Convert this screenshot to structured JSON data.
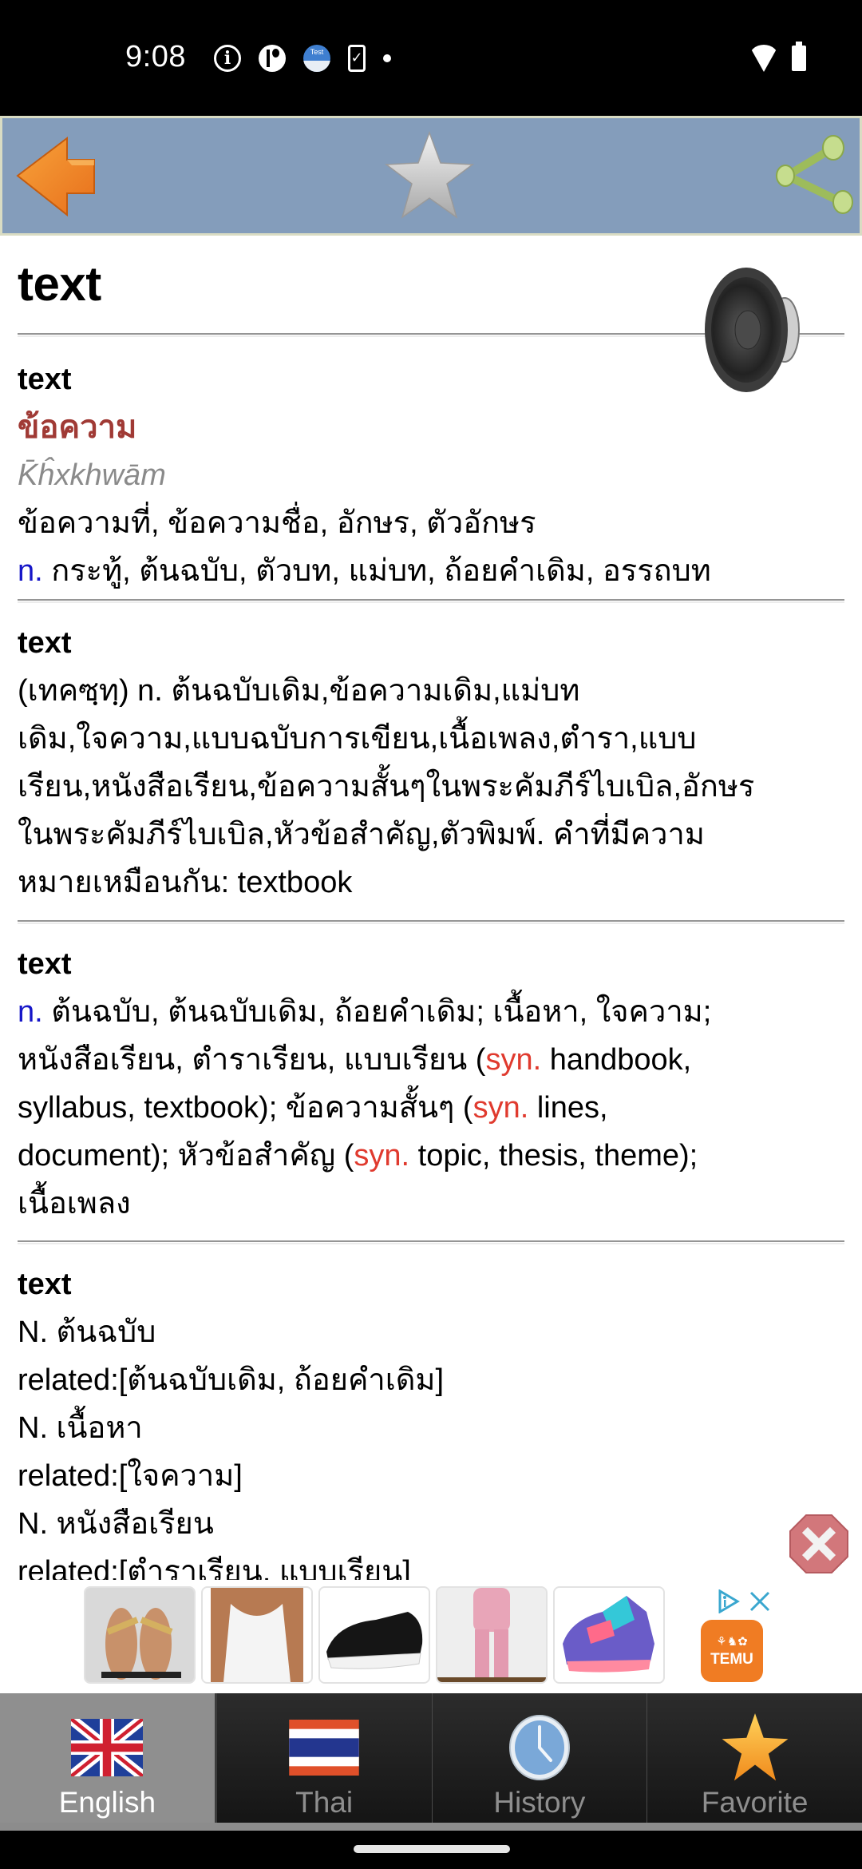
{
  "status_bar": {
    "time": "9:08",
    "left_icons": [
      "info-icon",
      "app-notification-icon",
      "test-app-icon",
      "phone-check-icon",
      "more-dot-icon"
    ],
    "right_icons": [
      "wifi-icon",
      "battery-charging-icon"
    ],
    "test_badge": "Test"
  },
  "toolbar": {
    "back_icon": "back-arrow-icon",
    "favorite_icon": "star-icon",
    "share_icon": "share-icon"
  },
  "word": {
    "headword": "text",
    "speaker_icon": "speaker-icon"
  },
  "entries": [
    {
      "word": "text",
      "thai": "ข้อความ",
      "transliteration": "K̄ĥxkhwām",
      "meanings": "ข้อความที่, ข้อความชื่อ, อักษร, ตัวอักษร",
      "pos": "n.",
      "pos_meanings": " กระทู้, ต้นฉบับ, ตัวบท, แม่บท, ถ้อยคำเดิม, อรรถบท"
    },
    {
      "word": "text",
      "lines": [
        "(เทคซฺทฺ) n. ต้นฉบับเดิม,ข้อความเดิม,แม่บท",
        "เดิม,ใจความ,แบบฉบับการเขียน,เนื้อเพลง,ตำรา,แบบ",
        "เรียน,หนังสือเรียน,ข้อความสั้นๆในพระคัมภีร์ไบเบิล,อักษร",
        "ในพระคัมภีร์ไบเบิล,หัวข้อสำคัญ,ตัวพิมพ์. คำที่มีความ",
        "หมายเหมือนกัน: textbook"
      ]
    },
    {
      "word": "text",
      "pos": "n.",
      "segments": [
        {
          "text": " ต้นฉบับ, ต้นฉบับเดิม, ถ้อยคำเดิม; เนื้อหา, ใจความ;",
          "break_after": true
        },
        {
          "text": "หนังสือเรียน, ตำราเรียน, แบบเรียน ("
        },
        {
          "syn": "syn."
        },
        {
          "text": " handbook,",
          "break_after": true
        },
        {
          "text": "syllabus, textbook); ข้อความสั้นๆ ("
        },
        {
          "syn": "syn."
        },
        {
          "text": " lines,",
          "break_after": true
        },
        {
          "text": "document); หัวข้อสำคัญ ("
        },
        {
          "syn": "syn."
        },
        {
          "text": " topic, thesis, theme);",
          "break_after": true
        },
        {
          "text": "เนื้อเพลง"
        }
      ]
    },
    {
      "word": "text",
      "lines": [
        "N. ต้นฉบับ",
        "related:[ต้นฉบับเดิม, ถ้อยคำเดิม]",
        "N. เนื้อหา",
        "related:[ใจความ]",
        "N. หนังสือเรียน",
        "related:[ตำราเรียน, แบบเรียน]"
      ]
    }
  ],
  "ad": {
    "close_icon": "close-ad-icon",
    "products": [
      "sandals",
      "white tank top",
      "black sneakers",
      "pink tracksuit",
      "colorful sneakers"
    ],
    "brand": "TEMU",
    "adchoices_icon": "adchoices-icon",
    "dismiss_icon": "ad-dismiss-icon"
  },
  "bottom_nav": {
    "tabs": [
      {
        "label": "English",
        "icon": "uk-flag-icon",
        "active": true
      },
      {
        "label": "Thai",
        "icon": "thai-flag-icon",
        "active": false
      },
      {
        "label": "History",
        "icon": "clock-icon",
        "active": false
      },
      {
        "label": "Favorite",
        "icon": "star-icon",
        "active": false
      }
    ]
  },
  "colors": {
    "toolbar_bg": "#849dbb",
    "toolbar_border": "#d9dcc3",
    "thai_headword": "#a03a35",
    "pos_color": "#1616c8",
    "syn_color": "#e03a2e",
    "transliteration": "#8a8a8a",
    "active_tab_bg": "#8f8f8f",
    "nav_bg": "#1f1f1f"
  }
}
